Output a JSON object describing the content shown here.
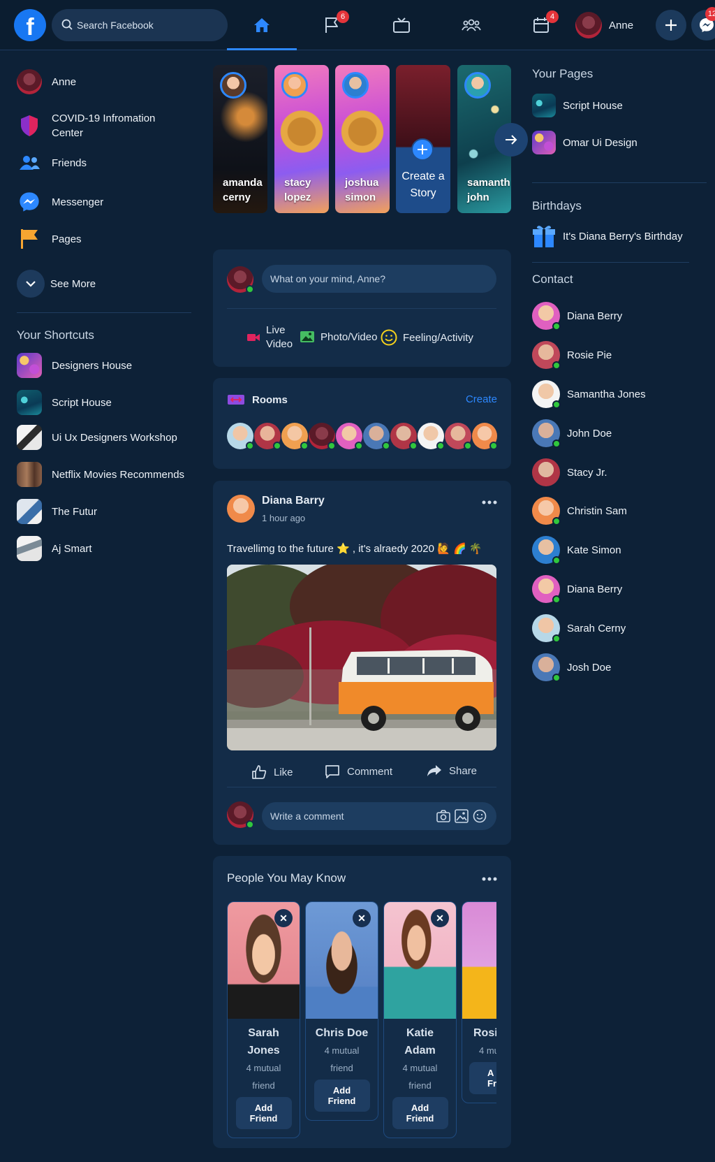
{
  "topbar": {
    "search_placeholder": "Search Facebook",
    "flag_badge": "6",
    "calendar_badge": "4",
    "messenger_badge": "12",
    "profile_name": "Anne"
  },
  "left_nav": {
    "items": [
      {
        "label": "Anne"
      },
      {
        "label": "COVID-19 Infromation Center"
      },
      {
        "label": "Friends"
      },
      {
        "label": "Messenger"
      },
      {
        "label": "Pages"
      },
      {
        "label": "See More"
      }
    ],
    "shortcuts_title": "Your Shortcuts",
    "shortcuts": [
      {
        "label": "Designers House"
      },
      {
        "label": "Script House"
      },
      {
        "label": "Ui Ux Designers Workshop"
      },
      {
        "label": "Netflix Movies Recommends"
      },
      {
        "label": "The Futur"
      },
      {
        "label": "Aj Smart"
      }
    ]
  },
  "stories": [
    {
      "name_line1": "amanda",
      "name_line2": "cerny"
    },
    {
      "name_line1": "stacy",
      "name_line2": "lopez"
    },
    {
      "name_line1": "joshua",
      "name_line2": "simon"
    },
    {
      "create_line1": "Create a",
      "create_line2": "Story"
    },
    {
      "name_line1": "samanth",
      "name_line2": "john"
    }
  ],
  "composer": {
    "placeholder": "What on your mind, Anne?",
    "live_line1": "Live",
    "live_line2": "Video",
    "photo": "Photo/Video",
    "feeling": "Feeling/Activity"
  },
  "rooms": {
    "title": "Rooms",
    "create": "Create"
  },
  "post": {
    "author": "Diana Barry",
    "time": "1 hour ago",
    "text": "Travellimg to the future ⭐ , it's alraedy 2020 🙋 🌈 🌴",
    "like": "Like",
    "comment": "Comment",
    "share": "Share",
    "comment_placeholder": "Write a comment"
  },
  "pymk": {
    "title": "People You May Know",
    "people": [
      {
        "name": "Sarah Jones",
        "mutual": "4 mutual friend",
        "btn1": "Add",
        "btn2": "Friend"
      },
      {
        "name": "Chris Doe",
        "mutual": "4 mutual friend",
        "btn1": "Add",
        "btn2": "Friend"
      },
      {
        "name": "Katie Adam",
        "mutual": "4 mutual friend",
        "btn1": "Add",
        "btn2": "Friend"
      },
      {
        "name": "Rosi",
        "mutual": "4 mu",
        "btn1": "A",
        "btn2": "Fri"
      }
    ]
  },
  "right": {
    "pages_title": "Your Pages",
    "pages": [
      {
        "label": "Script House"
      },
      {
        "label": "Omar Ui Design"
      }
    ],
    "birthdays_title": "Birthdays",
    "birthday_text": "It's Diana Berry's Birthday",
    "contact_title": "Contact",
    "contacts": [
      {
        "name": "Diana Berry"
      },
      {
        "name": "Rosie Pie"
      },
      {
        "name": "Samantha Jones"
      },
      {
        "name": "John Doe"
      },
      {
        "name": "Stacy Jr."
      },
      {
        "name": "Christin Sam"
      },
      {
        "name": "Kate Simon"
      },
      {
        "name": "Diana Berry"
      },
      {
        "name": "Sarah Cerny"
      },
      {
        "name": "Josh Doe"
      }
    ]
  },
  "colors": {
    "background": "#0d2137",
    "card": "#132c48",
    "accent": "#2d88ff",
    "online": "#30c73d",
    "badge": "#e4343a"
  }
}
